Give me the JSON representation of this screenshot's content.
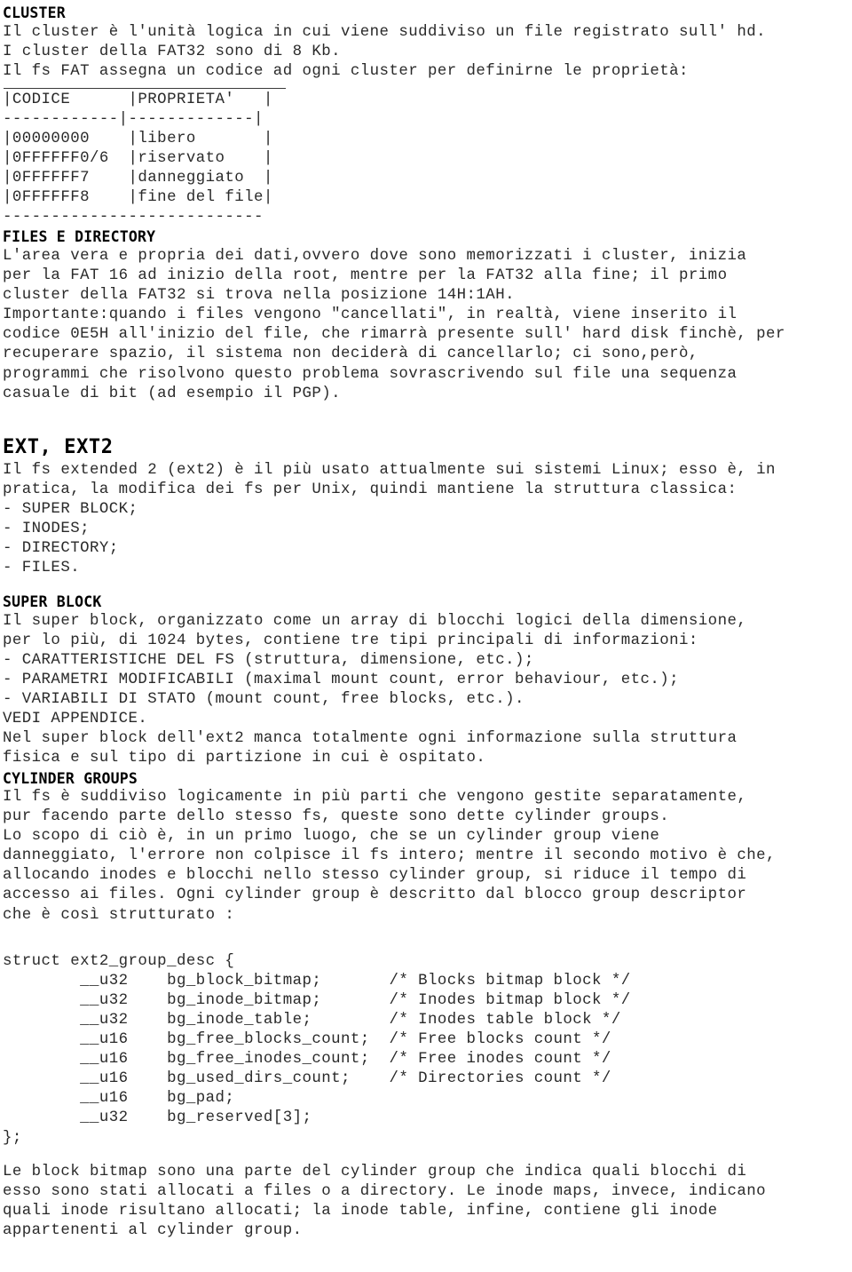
{
  "document": {
    "title": "CLUSTER",
    "sections": {
      "cluster": {
        "heading": "CLUSTER",
        "lines": [
          "Il cluster è l'unità logica in cui viene suddiviso un file registrato sull' hd.",
          "I cluster della FAT32 sono di 8 Kb.",
          "Il fs FAT assegna un codice ad ogni cluster per definirne le proprietà:"
        ]
      },
      "code_table": {
        "headers": [
          "CODICE",
          "PROPRIETA'"
        ],
        "ascii_lines": [
          "|CODICE      |PROPRIETA'   |",
          "------------|-------------|",
          "|00000000    |libero       |",
          "|0FFFFFF0/6  |riservato    |",
          "|0FFFFFF7    |danneggiato  |",
          "|0FFFFFF8    |fine del file|",
          "---------------------------"
        ],
        "rows": [
          {
            "codice": "00000000",
            "proprieta": "libero"
          },
          {
            "codice": "0FFFFFF0/6",
            "proprieta": "riservato"
          },
          {
            "codice": "0FFFFFF7",
            "proprieta": "danneggiato"
          },
          {
            "codice": "0FFFFFF8",
            "proprieta": "fine del file"
          }
        ]
      },
      "files_e_directory": {
        "heading": "FILES E DIRECTORY",
        "lines": [
          "L'area vera e propria dei dati,ovvero dove sono memorizzati i cluster, inizia",
          "per la FAT 16 ad inizio della root, mentre per la FAT32 alla fine; il primo",
          "cluster della FAT32 si trova nella posizione 14H:1AH.",
          "Importante:quando i files vengono \"cancellati\", in realtà, viene inserito il",
          "codice 0E5H all'inizio del file, che rimarrà presente sull' hard disk finchè, per",
          "recuperare spazio, il sistema non deciderà di cancellarlo; ci sono,però,",
          "programmi che risolvono questo problema sovrascrivendo sul file una sequenza",
          "casuale di bit (ad esempio il PGP)."
        ]
      },
      "ext_ext2": {
        "heading": "EXT, EXT2",
        "lines": [
          "Il fs extended 2 (ext2) è il più usato attualmente sui sistemi Linux; esso è, in",
          "pratica, la modifica dei fs per Unix, quindi mantiene la struttura classica:",
          "- SUPER BLOCK;",
          "- INODES;",
          "- DIRECTORY;",
          "- FILES."
        ]
      },
      "super_block": {
        "heading": "SUPER BLOCK",
        "lines": [
          "Il super block, organizzato come un array di blocchi logici della dimensione,",
          "per lo più, di 1024 bytes, contiene tre tipi principali di informazioni:",
          "- CARATTERISTICHE DEL FS (struttura, dimensione, etc.);",
          "- PARAMETRI MODIFICABILI (maximal mount count, error behaviour, etc.);",
          "- VARIABILI DI STATO (mount count, free blocks, etc.).",
          "VEDI APPENDICE.",
          "Nel super block dell'ext2 manca totalmente ogni informazione sulla struttura",
          "fisica e sul tipo di partizione in cui è ospitato."
        ]
      },
      "cylinder_groups": {
        "heading": "CYLINDER GROUPS",
        "lines": [
          "Il fs è suddiviso logicamente in più parti che vengono gestite separatamente,",
          "pur facendo parte dello stesso fs, queste sono dette cylinder groups.",
          "Lo scopo di ciò è, in un primo luogo, che se un cylinder group viene",
          "danneggiato, l'errore non colpisce il fs intero; mentre il secondo motivo è che,",
          "allocando inodes e blocchi nello stesso cylinder group, si riduce il tempo di",
          "accesso ai files. Ogni cylinder group è descritto dal blocco group descriptor",
          "che è così strutturato :"
        ]
      },
      "struct_block": {
        "open_line": "struct ext2_group_desc {",
        "close_line": "};",
        "fields": [
          {
            "type": "__u32",
            "name": "bg_block_bitmap;",
            "comment": "/* Blocks bitmap block */"
          },
          {
            "type": "__u32",
            "name": "bg_inode_bitmap;",
            "comment": "/* Inodes bitmap block */"
          },
          {
            "type": "__u32",
            "name": "bg_inode_table;",
            "comment": "/* Inodes table block */"
          },
          {
            "type": "__u16",
            "name": "bg_free_blocks_count;",
            "comment": "/* Free blocks count */"
          },
          {
            "type": "__u16",
            "name": "bg_free_inodes_count;",
            "comment": "/* Free inodes count */"
          },
          {
            "type": "__u16",
            "name": "bg_used_dirs_count;",
            "comment": "/* Directories count */"
          },
          {
            "type": "__u16",
            "name": "bg_pad;",
            "comment": ""
          },
          {
            "type": "__u32",
            "name": "bg_reserved[3];",
            "comment": ""
          }
        ],
        "rendered_lines": [
          "struct ext2_group_desc {",
          "        __u32    bg_block_bitmap;       /* Blocks bitmap block */",
          "        __u32    bg_inode_bitmap;       /* Inodes bitmap block */",
          "        __u32    bg_inode_table;        /* Inodes table block */",
          "        __u16    bg_free_blocks_count;  /* Free blocks count */",
          "        __u16    bg_free_inodes_count;  /* Free inodes count */",
          "        __u16    bg_used_dirs_count;    /* Directories count */",
          "        __u16    bg_pad;",
          "        __u32    bg_reserved[3];",
          "};"
        ]
      },
      "bitmaps": {
        "lines": [
          "Le block bitmap sono una parte del cylinder group che indica quali blocchi di",
          "esso sono stati allocati a files o a directory. Le inode maps, invece, indicano",
          "quali inode risultano allocati; la inode table, infine, contiene gli inode",
          "appartenenti al cylinder group."
        ]
      }
    }
  }
}
